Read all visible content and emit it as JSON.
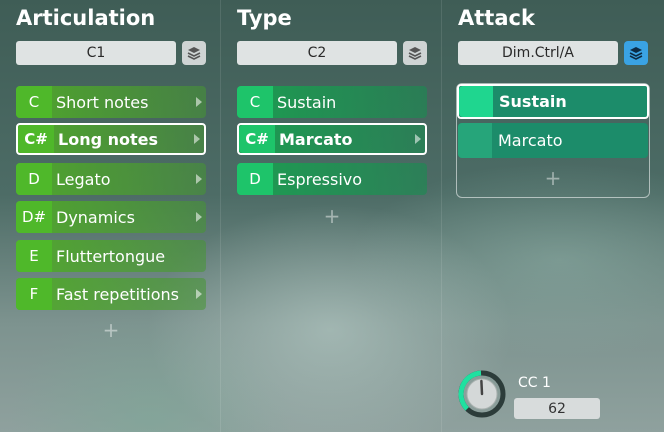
{
  "columns": {
    "articulation": {
      "title": "Articulation",
      "selector": "C1",
      "icon": "layers-icon",
      "items": [
        {
          "note": "C",
          "label": "Short notes",
          "has_arrow": true
        },
        {
          "note": "C#",
          "label": "Long notes",
          "has_arrow": true,
          "selected": true
        },
        {
          "note": "D",
          "label": "Legato",
          "has_arrow": true
        },
        {
          "note": "D#",
          "label": "Dynamics",
          "has_arrow": true
        },
        {
          "note": "E",
          "label": "Fluttertongue",
          "has_arrow": false
        },
        {
          "note": "F",
          "label": "Fast repetitions",
          "has_arrow": true
        }
      ],
      "add_label": "+"
    },
    "type": {
      "title": "Type",
      "selector": "C2",
      "icon": "layers-icon",
      "items": [
        {
          "note": "C",
          "label": "Sustain",
          "has_arrow": false
        },
        {
          "note": "C#",
          "label": "Marcato",
          "has_arrow": true,
          "selected": true
        },
        {
          "note": "D",
          "label": "Espressivo",
          "has_arrow": false
        }
      ],
      "add_label": "+"
    },
    "attack": {
      "title": "Attack",
      "selector": "Dim.Ctrl/A",
      "icon": "layers-icon",
      "icon_active": true,
      "items": [
        {
          "label": "Sustain",
          "selected": true
        },
        {
          "label": "Marcato",
          "selected": false
        }
      ],
      "add_label": "+"
    }
  },
  "controller": {
    "label": "CC 1",
    "value": "62",
    "fraction": 0.49
  },
  "colors": {
    "articulation_accent": "#4fb82a",
    "type_accent": "#1ec46a",
    "attack_accent": "#1c8c6a",
    "attack_selected_swatch": "#1fd68f",
    "layers_active": "#3aa3e4",
    "knob_arc": "#1fe0a0"
  }
}
